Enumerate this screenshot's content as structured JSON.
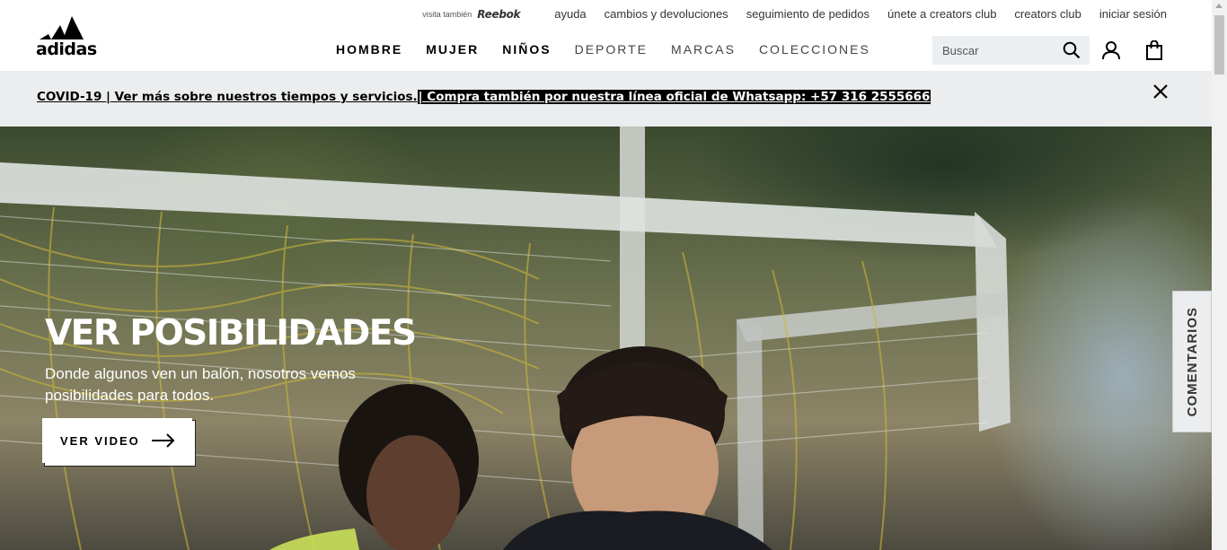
{
  "header": {
    "logo_text": "adidas",
    "utility": {
      "also_visit": "visita también",
      "reebok": "Reebok",
      "links": [
        "ayuda",
        "cambios y devoluciones",
        "seguimiento de pedidos",
        "únete a creators club",
        "creators club",
        "iniciar sesión"
      ]
    },
    "nav": [
      {
        "label": "HOMBRE",
        "weight": "bold"
      },
      {
        "label": "MUJER",
        "weight": "bold"
      },
      {
        "label": "NIÑOS",
        "weight": "bold"
      },
      {
        "label": "DEPORTE",
        "weight": "light"
      },
      {
        "label": "MARCAS",
        "weight": "light"
      },
      {
        "label": "COLECCIONES",
        "weight": "light"
      }
    ],
    "search": {
      "placeholder": "Buscar",
      "icon": "search-icon"
    },
    "user_icon": "user-icon",
    "bag_icon": "bag-icon"
  },
  "banner": {
    "text_part1": "COVID-19 | Ver más sobre nuestros tiempos y servicios.",
    "text_part2": "| Compra también por nuestra línea oficial de Whatsapp: +57 316 2555666",
    "close_icon": "close-icon"
  },
  "hero": {
    "title": "VER POSIBILIDADES",
    "subtitle": "Donde algunos ven un balón, nosotros vemos posibilidades para todos.",
    "button_label": "VER VIDEO",
    "button_icon": "arrow-right-icon"
  },
  "feedback": {
    "label": "COMENTARIOS"
  },
  "colors": {
    "banner_bg": "#ebedee",
    "search_bg": "#eceff1",
    "text": "#000000"
  }
}
